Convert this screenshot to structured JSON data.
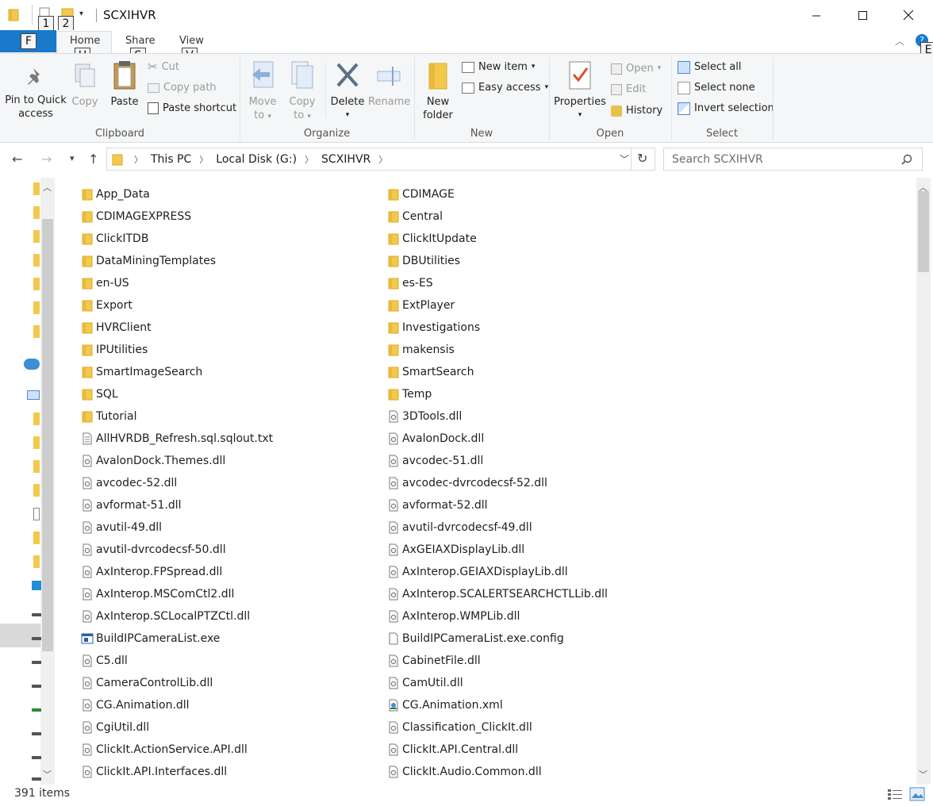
{
  "window": {
    "title": "SCXIHVR",
    "qat_keytips": [
      "1",
      "2"
    ]
  },
  "tabs": {
    "file": {
      "label": "F"
    },
    "items": [
      {
        "label": "Home",
        "keytip": "H"
      },
      {
        "label": "Share",
        "keytip": "S"
      },
      {
        "label": "View",
        "keytip": "V"
      }
    ],
    "help_keytip": "E"
  },
  "ribbon": {
    "clipboard": {
      "group_label": "Clipboard",
      "pin_line1": "Pin to Quick",
      "pin_line2": "access",
      "copy": "Copy",
      "paste": "Paste",
      "cut": "Cut",
      "copy_path": "Copy path",
      "paste_shortcut": "Paste shortcut"
    },
    "organize": {
      "group_label": "Organize",
      "move_line1": "Move",
      "move_line2": "to",
      "copy_line1": "Copy",
      "copy_line2": "to",
      "delete": "Delete",
      "rename": "Rename"
    },
    "new": {
      "group_label": "New",
      "folder_line1": "New",
      "folder_line2": "folder",
      "new_item": "New item",
      "easy_access": "Easy access"
    },
    "open": {
      "group_label": "Open",
      "properties": "Properties",
      "open": "Open",
      "edit": "Edit",
      "history": "History"
    },
    "select": {
      "group_label": "Select",
      "select_all": "Select all",
      "select_none": "Select none",
      "invert": "Invert selection"
    }
  },
  "address": {
    "crumbs": [
      "This PC",
      "Local Disk (G:)",
      "SCXIHVR"
    ],
    "search_placeholder": "Search SCXIHVR"
  },
  "files": [
    {
      "name": "App_Data",
      "type": "folder"
    },
    {
      "name": "CDIMAGE",
      "type": "folder"
    },
    {
      "name": "CDIMAGEXPRESS",
      "type": "folder"
    },
    {
      "name": "Central",
      "type": "folder"
    },
    {
      "name": "ClickITDB",
      "type": "folder"
    },
    {
      "name": "ClickItUpdate",
      "type": "folder"
    },
    {
      "name": "DataMiningTemplates",
      "type": "folder"
    },
    {
      "name": "DBUtilities",
      "type": "folder"
    },
    {
      "name": "en-US",
      "type": "folder"
    },
    {
      "name": "es-ES",
      "type": "folder"
    },
    {
      "name": "Export",
      "type": "folder"
    },
    {
      "name": "ExtPlayer",
      "type": "folder"
    },
    {
      "name": "HVRClient",
      "type": "folder"
    },
    {
      "name": "Investigations",
      "type": "folder"
    },
    {
      "name": "IPUtilities",
      "type": "folder"
    },
    {
      "name": "makensis",
      "type": "folder"
    },
    {
      "name": "SmartImageSearch",
      "type": "folder"
    },
    {
      "name": "SmartSearch",
      "type": "folder"
    },
    {
      "name": "SQL",
      "type": "folder"
    },
    {
      "name": "Temp",
      "type": "folder"
    },
    {
      "name": "Tutorial",
      "type": "folder"
    },
    {
      "name": "3DTools.dll",
      "type": "dll"
    },
    {
      "name": "AllHVRDB_Refresh.sql.sqlout.txt",
      "type": "txt"
    },
    {
      "name": "AvalonDock.dll",
      "type": "dll"
    },
    {
      "name": "AvalonDock.Themes.dll",
      "type": "dll"
    },
    {
      "name": "avcodec-51.dll",
      "type": "dll"
    },
    {
      "name": "avcodec-52.dll",
      "type": "dll"
    },
    {
      "name": "avcodec-dvrcodecsf-52.dll",
      "type": "dll"
    },
    {
      "name": "avformat-51.dll",
      "type": "dll"
    },
    {
      "name": "avformat-52.dll",
      "type": "dll"
    },
    {
      "name": "avutil-49.dll",
      "type": "dll"
    },
    {
      "name": "avutil-dvrcodecsf-49.dll",
      "type": "dll"
    },
    {
      "name": "avutil-dvrcodecsf-50.dll",
      "type": "dll"
    },
    {
      "name": "AxGEIAXDisplayLib.dll",
      "type": "dll"
    },
    {
      "name": "AxInterop.FPSpread.dll",
      "type": "dll"
    },
    {
      "name": "AxInterop.GEIAXDisplayLib.dll",
      "type": "dll"
    },
    {
      "name": "AxInterop.MSComCtl2.dll",
      "type": "dll"
    },
    {
      "name": "AxInterop.SCALERTSEARCHCTLLib.dll",
      "type": "dll"
    },
    {
      "name": "AxInterop.SCLocalPTZCtl.dll",
      "type": "dll"
    },
    {
      "name": "AxInterop.WMPLib.dll",
      "type": "dll"
    },
    {
      "name": "BuildIPCameraList.exe",
      "type": "exe"
    },
    {
      "name": "BuildIPCameraList.exe.config",
      "type": "file"
    },
    {
      "name": "C5.dll",
      "type": "dll"
    },
    {
      "name": "CabinetFile.dll",
      "type": "dll"
    },
    {
      "name": "CameraControlLib.dll",
      "type": "dll"
    },
    {
      "name": "CamUtil.dll",
      "type": "dll"
    },
    {
      "name": "CG.Animation.dll",
      "type": "dll"
    },
    {
      "name": "CG.Animation.xml",
      "type": "xml"
    },
    {
      "name": "CgiUtil.dll",
      "type": "dll"
    },
    {
      "name": "Classification_ClickIt.dll",
      "type": "dll"
    },
    {
      "name": "ClickIt.ActionService.API.dll",
      "type": "dll"
    },
    {
      "name": "ClickIt.API.Central.dll",
      "type": "dll"
    },
    {
      "name": "ClickIt.API.Interfaces.dll",
      "type": "dll"
    },
    {
      "name": "ClickIt.Audio.Common.dll",
      "type": "dll"
    }
  ],
  "status": {
    "item_count": "391 items"
  },
  "colors": {
    "file_tab": "#1979ca",
    "folder": "#f2c94c",
    "accent": "#0063b1"
  }
}
